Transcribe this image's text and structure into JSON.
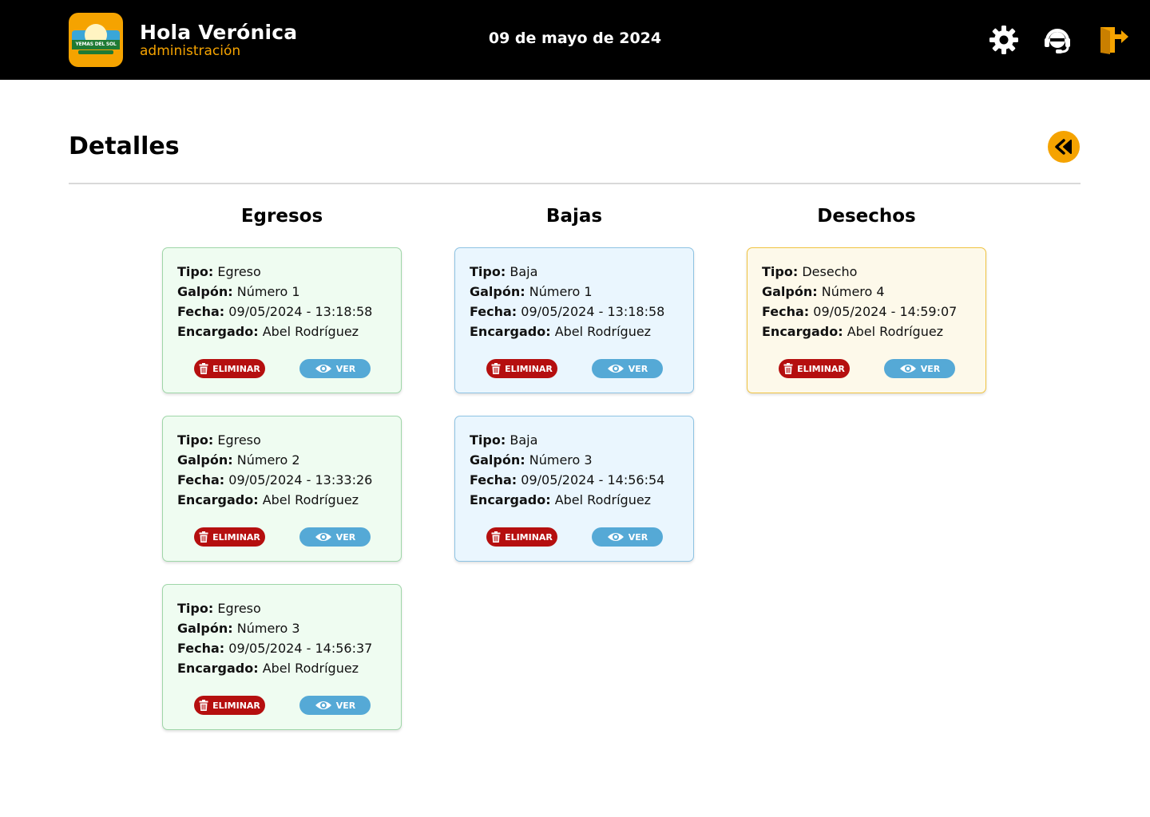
{
  "header": {
    "logo_text": "YEMAS DEL SOL",
    "greeting": "Hola Verónica",
    "role": "administración",
    "date": "09 de mayo de 2024",
    "icons": [
      "gear-icon",
      "support-icon",
      "logout-icon"
    ]
  },
  "page": {
    "title": "Detalles",
    "back_icon": "rewind-icon"
  },
  "labels": {
    "tipo": "Tipo:",
    "galpon": "Galpón:",
    "fecha": "Fecha:",
    "encargado": "Encargado:",
    "delete": "ELIMINAR",
    "view": "VER"
  },
  "colors": {
    "accent": "#f5a300",
    "delete": "#b50f0f",
    "view": "#55a9d6"
  },
  "columns": [
    {
      "title": "Egresos",
      "records": [
        {
          "tipo": "Egreso",
          "galpon": "Número 1",
          "fecha": "09/05/2024 - 13:18:58",
          "encargado": "Abel Rodríguez"
        },
        {
          "tipo": "Egreso",
          "galpon": "Número 2",
          "fecha": "09/05/2024 - 13:33:26",
          "encargado": "Abel Rodríguez"
        },
        {
          "tipo": "Egreso",
          "galpon": "Número 3",
          "fecha": "09/05/2024 - 14:56:37",
          "encargado": "Abel Rodríguez"
        }
      ]
    },
    {
      "title": "Bajas",
      "records": [
        {
          "tipo": "Baja",
          "galpon": "Número 1",
          "fecha": "09/05/2024 - 13:18:58",
          "encargado": "Abel Rodríguez"
        },
        {
          "tipo": "Baja",
          "galpon": "Número 3",
          "fecha": "09/05/2024 - 14:56:54",
          "encargado": "Abel Rodríguez"
        }
      ]
    },
    {
      "title": "Desechos",
      "records": [
        {
          "tipo": "Desecho",
          "galpon": "Número 4",
          "fecha": "09/05/2024 - 14:59:07",
          "encargado": "Abel Rodríguez"
        }
      ]
    }
  ]
}
